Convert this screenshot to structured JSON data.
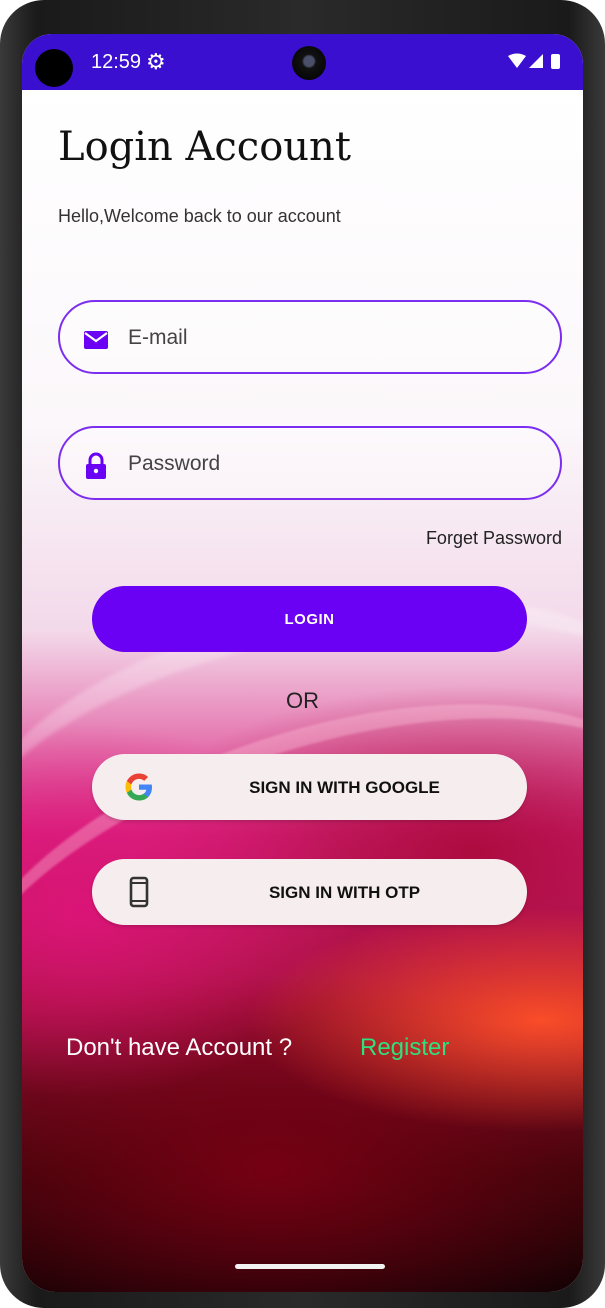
{
  "statusbar": {
    "time": "12:59",
    "settings_icon": "gear-icon",
    "signal_icons": [
      "wifi-icon",
      "cellular-icon",
      "battery-icon"
    ],
    "color": "#3a0fd0"
  },
  "header": {
    "title": "Login Account",
    "subtitle": "Hello,Welcome back to our account"
  },
  "form": {
    "email": {
      "placeholder": "E-mail",
      "icon": "mail-icon"
    },
    "password": {
      "placeholder": "Password",
      "icon": "lock-icon"
    },
    "forgot_label": "Forget Password",
    "login_label": "LOGIN",
    "accent": "#6a00f4"
  },
  "divider": {
    "or_label": "OR"
  },
  "social": {
    "google_label": "SIGN IN WITH GOOGLE",
    "google_icon": "google-icon",
    "otp_label": "SIGN IN WITH OTP",
    "otp_icon": "phone-icon"
  },
  "footer": {
    "prompt": "Don't have Account ?",
    "register_label": "Register",
    "register_color": "#2fe07f"
  }
}
